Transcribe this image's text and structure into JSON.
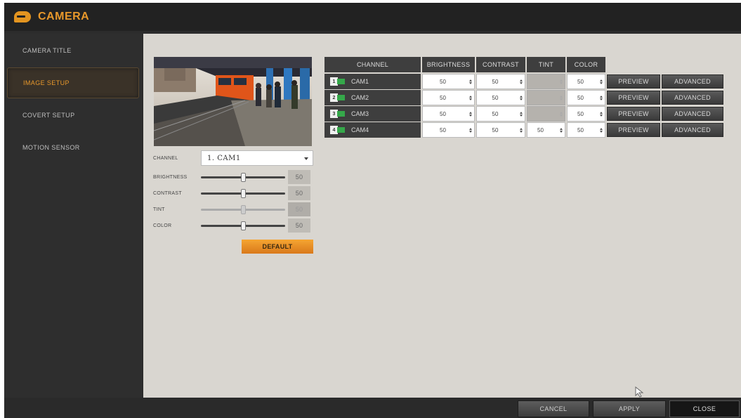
{
  "window": {
    "title": "CAMERA"
  },
  "sidebar": {
    "items": [
      {
        "label": "CAMERA TITLE",
        "active": false
      },
      {
        "label": "IMAGE SETUP",
        "active": true
      },
      {
        "label": "COVERT SETUP",
        "active": false
      },
      {
        "label": "MOTION SENSOR",
        "active": false
      }
    ]
  },
  "image_panel": {
    "channel_label": "CHANNEL",
    "channel_value": "1. CAM1",
    "brightness": {
      "label": "BRIGHTNESS",
      "value": "50",
      "level": 0.5,
      "enabled": true
    },
    "contrast": {
      "label": "CONTRAST",
      "value": "50",
      "level": 0.5,
      "enabled": true
    },
    "tint": {
      "label": "TINT",
      "value": "50",
      "level": 0.5,
      "enabled": false
    },
    "color": {
      "label": "COLOR",
      "value": "50",
      "level": 0.5,
      "enabled": true
    },
    "default_label": "DEFAULT"
  },
  "table": {
    "headers": [
      "CHANNEL",
      "BRIGHTNESS",
      "CONTRAST",
      "TINT",
      "COLOR"
    ],
    "rows": [
      {
        "num": "1",
        "name": "CAM1",
        "brightness": "50",
        "contrast": "50",
        "tint": "",
        "tint_enabled": false,
        "color": "50"
      },
      {
        "num": "2",
        "name": "CAM2",
        "brightness": "50",
        "contrast": "50",
        "tint": "",
        "tint_enabled": false,
        "color": "50"
      },
      {
        "num": "3",
        "name": "CAM3",
        "brightness": "50",
        "contrast": "50",
        "tint": "",
        "tint_enabled": false,
        "color": "50"
      },
      {
        "num": "4",
        "name": "CAM4",
        "brightness": "50",
        "contrast": "50",
        "tint": "50",
        "tint_enabled": true,
        "color": "50"
      }
    ],
    "preview_label": "PREVIEW",
    "advanced_label": "ADVANCED"
  },
  "footer": {
    "cancel_label": "CANCEL",
    "apply_label": "APPLY",
    "close_label": "CLOSE"
  },
  "colors": {
    "accent": "#e8982b",
    "panel": "#d9d6d0",
    "frame": "#2c2c2c"
  }
}
